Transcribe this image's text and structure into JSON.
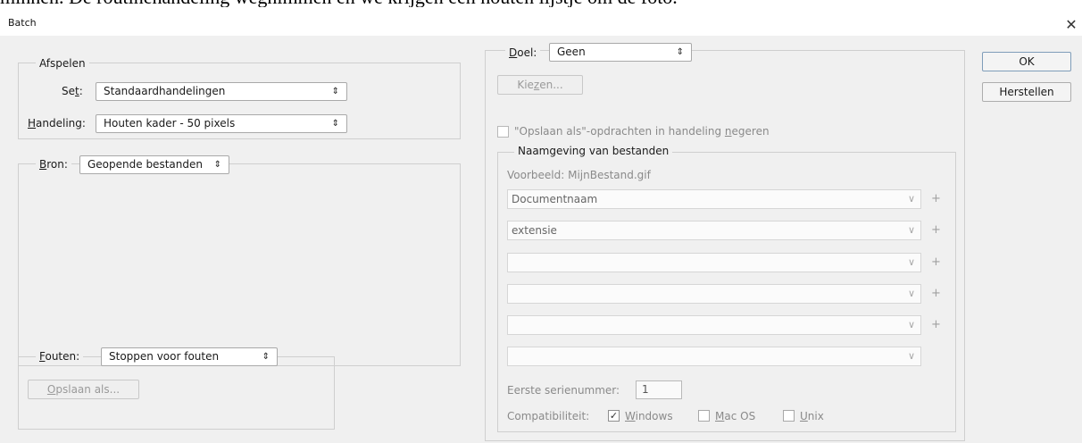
{
  "background_text": "minnen. De routinehandeling wegnimmen en we krijgen een houten lijstje om de foto.",
  "window": {
    "title": "Batch",
    "close_glyph": "✕"
  },
  "play": {
    "legend": "Afspelen",
    "set_label": "Set:",
    "set_value": "Standaardhandelingen",
    "action_label": "Handeling:",
    "action_value": "Houten kader - 50 pixels"
  },
  "source": {
    "label": "Bron:",
    "value": "Geopende bestanden"
  },
  "errors": {
    "label": "Fouten:",
    "value": "Stoppen voor fouten",
    "save_as_button": "Opslaan als..."
  },
  "destination": {
    "label": "Doel:",
    "value": "Geen",
    "choose_button": "Kiezen...",
    "override_checkbox_label": "\"Opslaan als\"-opdrachten in handeling negeren",
    "override_checked": false
  },
  "naming": {
    "legend": "Naamgeving van bestanden",
    "example": "Voorbeeld: MijnBestand.gif",
    "fields": [
      "Documentnaam",
      "extensie",
      "",
      "",
      "",
      ""
    ],
    "serial_label": "Eerste serienummer:",
    "serial_value": "1",
    "compat_label": "Compatibiliteit:",
    "compat": [
      {
        "label": "Windows",
        "checked": true
      },
      {
        "label": "Mac OS",
        "checked": false
      },
      {
        "label": "Unix",
        "checked": false
      }
    ]
  },
  "buttons": {
    "ok": "OK",
    "reset": "Herstellen"
  },
  "icons": {
    "select_arrow": "⇕",
    "combo_chevron": "∨",
    "plus": "+",
    "check": "✓"
  }
}
